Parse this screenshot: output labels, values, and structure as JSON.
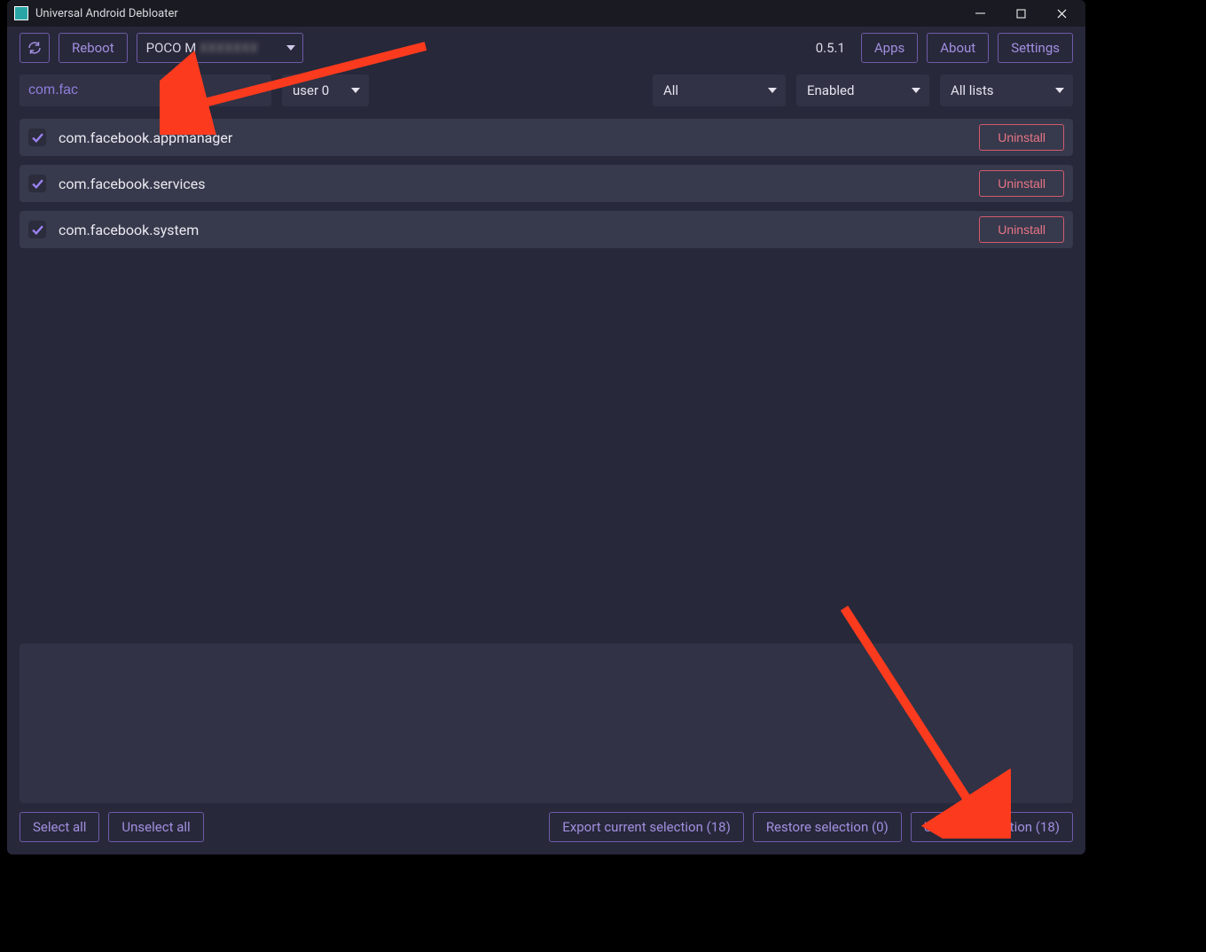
{
  "window": {
    "title": "Universal Android Debloater"
  },
  "topbar": {
    "reboot": "Reboot",
    "device": "POCO M",
    "version": "0.5.1",
    "apps": "Apps",
    "about": "About",
    "settings": "Settings"
  },
  "filterbar": {
    "search_value": "com.fac",
    "user": "user 0",
    "all": "All",
    "enabled": "Enabled",
    "lists": "All lists"
  },
  "packages": [
    {
      "name": "com.facebook.appmanager",
      "action": "Uninstall"
    },
    {
      "name": "com.facebook.services",
      "action": "Uninstall"
    },
    {
      "name": "com.facebook.system",
      "action": "Uninstall"
    }
  ],
  "bottom": {
    "select_all": "Select all",
    "unselect_all": "Unselect all",
    "export": "Export current selection (18)",
    "restore": "Restore selection (0)",
    "uninstall": "Uninstall selection (18)"
  }
}
